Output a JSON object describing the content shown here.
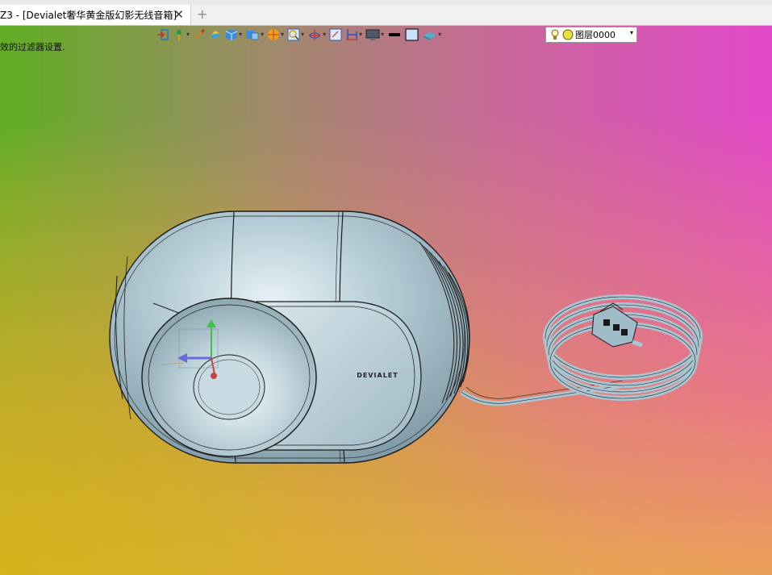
{
  "window": {
    "tab_title": "Z3 - [Devialet奢华黄金版幻影无线音箱]",
    "close_glyph": "✕",
    "new_tab_glyph": "+"
  },
  "status": {
    "filter_message": "效的过滤器设置."
  },
  "toolbar": {
    "buttons": [
      {
        "icon": "exit-icon",
        "has_dropdown": false
      },
      {
        "icon": "pick-point-icon",
        "has_dropdown": true
      },
      {
        "icon": "brush-icon",
        "has_dropdown": false
      },
      {
        "icon": "surface-icon",
        "has_dropdown": false
      },
      {
        "icon": "cube-icon",
        "has_dropdown": true
      },
      {
        "icon": "view-cube-icon",
        "has_dropdown": true
      },
      {
        "icon": "render-sphere-icon",
        "has_dropdown": true
      },
      {
        "icon": "zoom-icon",
        "has_dropdown": true
      },
      {
        "icon": "axis-icon",
        "has_dropdown": true
      },
      {
        "icon": "frame-icon",
        "has_dropdown": false
      },
      {
        "icon": "section-icon",
        "has_dropdown": true
      },
      {
        "icon": "display-icon",
        "has_dropdown": true
      },
      {
        "icon": "line-color-icon",
        "has_dropdown": false
      },
      {
        "icon": "fill-color-icon",
        "has_dropdown": false
      },
      {
        "icon": "material-icon",
        "has_dropdown": true
      }
    ],
    "layer": {
      "label": "图层0000",
      "icons": [
        "lightbulb-icon",
        "layer-color-icon"
      ],
      "dropdown_glyph": "▾"
    }
  },
  "model": {
    "brand_text": "DEVIALET",
    "body_color": "#a9c6d2",
    "edge_color": "#1a1a1a"
  },
  "colors": {
    "bg_left": "#5fae24",
    "bg_right": "#e248c8",
    "bg_bottom_left": "#d2b414",
    "bg_bottom_right": "#f08c8c"
  }
}
